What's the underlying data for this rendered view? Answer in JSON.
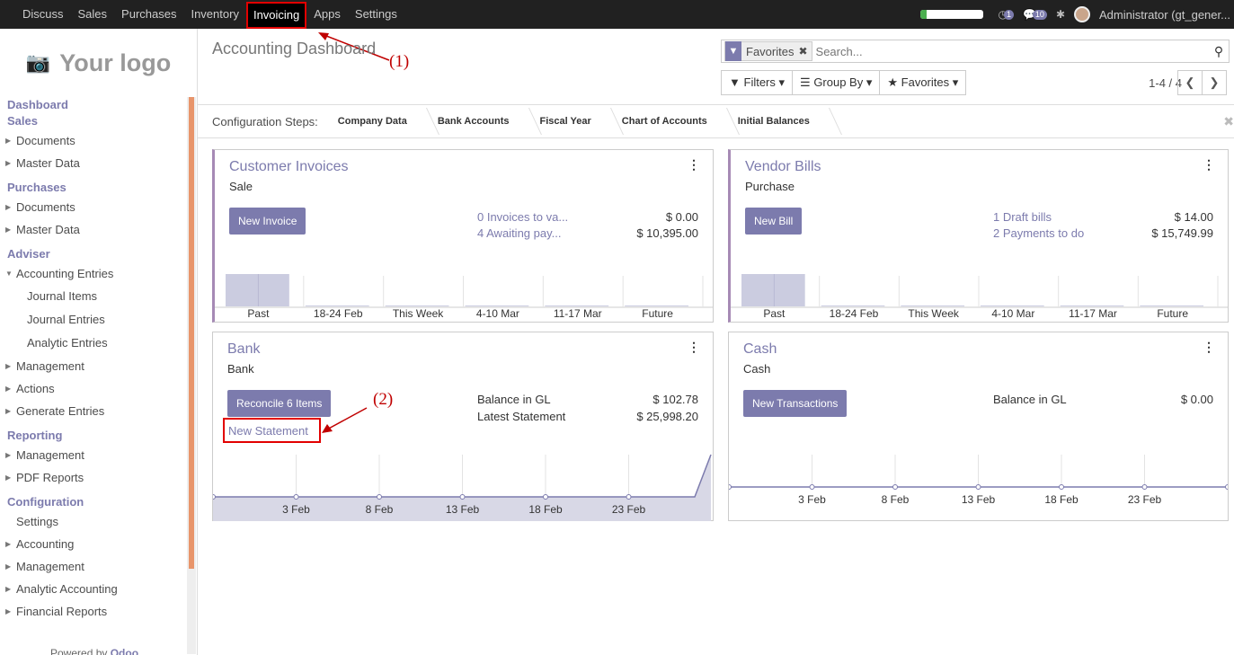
{
  "topbar": {
    "menu": [
      "Discuss",
      "Sales",
      "Purchases",
      "Inventory",
      "Invoicing",
      "Apps",
      "Settings"
    ],
    "active": "Invoicing",
    "progress": 0.1,
    "activity_count": "1",
    "message_count": "10",
    "user": "Administrator (gt_gener..."
  },
  "sidebar": {
    "logo_text": "Your logo",
    "sections": [
      {
        "title": "Dashboard"
      },
      {
        "title": "Sales",
        "items": [
          {
            "label": "Documents",
            "expandable": true
          },
          {
            "label": "Master Data",
            "expandable": true
          }
        ]
      },
      {
        "title": "Purchases",
        "items": [
          {
            "label": "Documents",
            "expandable": true
          },
          {
            "label": "Master Data",
            "expandable": true
          }
        ]
      },
      {
        "title": "Adviser",
        "items": [
          {
            "label": "Accounting Entries",
            "expandable": true,
            "open": true,
            "children": [
              "Journal Items",
              "Journal Entries",
              "Analytic Entries"
            ]
          },
          {
            "label": "Management",
            "expandable": true
          },
          {
            "label": "Actions",
            "expandable": true
          },
          {
            "label": "Generate Entries",
            "expandable": true
          }
        ]
      },
      {
        "title": "Reporting",
        "items": [
          {
            "label": "Management",
            "expandable": true
          },
          {
            "label": "PDF Reports",
            "expandable": true
          }
        ]
      },
      {
        "title": "Configuration",
        "items": [
          {
            "label": "Settings",
            "expandable": false
          },
          {
            "label": "Accounting",
            "expandable": true
          },
          {
            "label": "Management",
            "expandable": true
          },
          {
            "label": "Analytic Accounting",
            "expandable": true
          },
          {
            "label": "Financial Reports",
            "expandable": true
          }
        ]
      }
    ],
    "powered_prefix": "Powered by ",
    "powered_brand": "Odoo"
  },
  "header": {
    "title": "Accounting Dashboard",
    "search_facet": "Favorites",
    "search_placeholder": "Search...",
    "filters_label": "Filters",
    "groupby_label": "Group By",
    "favorites_label": "Favorites",
    "pager": "1-4 / 4"
  },
  "config_steps": {
    "label": "Configuration Steps:",
    "steps": [
      "Company Data",
      "Bank Accounts",
      "Fiscal Year",
      "Chart of Accounts",
      "Initial Balances"
    ]
  },
  "cards": {
    "customer_invoices": {
      "title": "Customer Invoices",
      "subtitle": "Sale",
      "button": "New Invoice",
      "rows": [
        {
          "label": "0 Invoices to va...",
          "value": "$ 0.00"
        },
        {
          "label": "4 Awaiting pay...",
          "value": "$ 10,395.00"
        }
      ],
      "chart_labels": [
        "Past",
        "18-24 Feb",
        "This Week",
        "4-10 Mar",
        "11-17 Mar",
        "Future"
      ]
    },
    "vendor_bills": {
      "title": "Vendor Bills",
      "subtitle": "Purchase",
      "button": "New Bill",
      "rows": [
        {
          "label": "1 Draft bills",
          "value": "$ 14.00"
        },
        {
          "label": "2 Payments to do",
          "value": "$ 15,749.99"
        }
      ],
      "chart_labels": [
        "Past",
        "18-24 Feb",
        "This Week",
        "4-10 Mar",
        "11-17 Mar",
        "Future"
      ]
    },
    "bank": {
      "title": "Bank",
      "subtitle": "Bank",
      "button": "Reconcile 6 Items",
      "link": "New Statement",
      "rows": [
        {
          "label": "Balance in GL",
          "value": "$ 102.78"
        },
        {
          "label": "Latest Statement",
          "value": "$ 25,998.20"
        }
      ],
      "chart_labels": [
        "3 Feb",
        "8 Feb",
        "13 Feb",
        "18 Feb",
        "23 Feb"
      ]
    },
    "cash": {
      "title": "Cash",
      "subtitle": "Cash",
      "button": "New Transactions",
      "rows": [
        {
          "label": "Balance in GL",
          "value": "$ 0.00"
        }
      ],
      "chart_labels": [
        "3 Feb",
        "8 Feb",
        "13 Feb",
        "18 Feb",
        "23 Feb"
      ]
    }
  },
  "annotations": {
    "a1": "(1)",
    "a2": "(2)"
  },
  "colors": {
    "accent": "#7c7bad",
    "highlight": "#e20000",
    "sidebar_scroll": "#e8956b"
  }
}
